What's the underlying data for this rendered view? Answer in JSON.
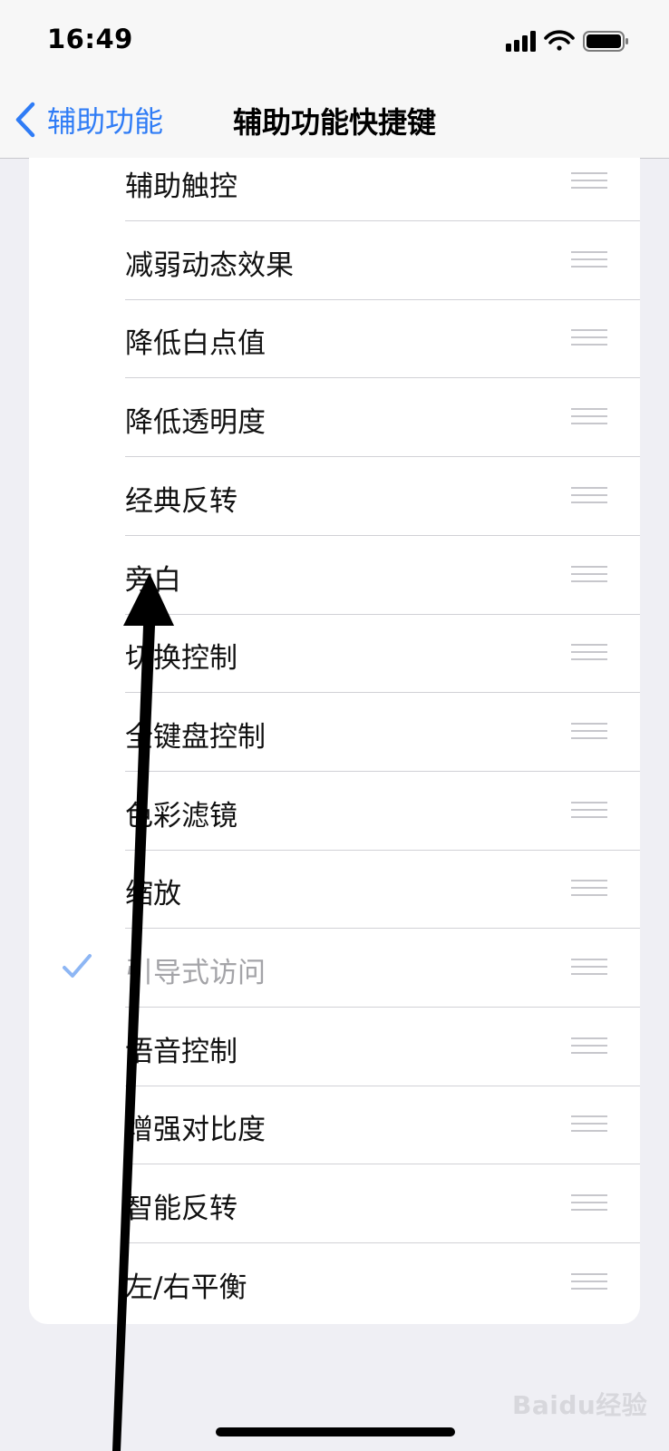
{
  "status_bar": {
    "time": "16:49"
  },
  "nav": {
    "back_label": "辅助功能",
    "title": "辅助功能快捷键"
  },
  "accent_color": "#2F7CF6",
  "items": [
    {
      "label": "辅助触控",
      "checked": false,
      "disabled": false
    },
    {
      "label": "减弱动态效果",
      "checked": false,
      "disabled": false
    },
    {
      "label": "降低白点值",
      "checked": false,
      "disabled": false
    },
    {
      "label": "降低透明度",
      "checked": false,
      "disabled": false
    },
    {
      "label": "经典反转",
      "checked": false,
      "disabled": false
    },
    {
      "label": "旁白",
      "checked": false,
      "disabled": false
    },
    {
      "label": "切换控制",
      "checked": false,
      "disabled": false
    },
    {
      "label": "全键盘控制",
      "checked": false,
      "disabled": false
    },
    {
      "label": "色彩滤镜",
      "checked": false,
      "disabled": false
    },
    {
      "label": "缩放",
      "checked": false,
      "disabled": false
    },
    {
      "label": "引导式访问",
      "checked": true,
      "disabled": true
    },
    {
      "label": "语音控制",
      "checked": false,
      "disabled": false
    },
    {
      "label": "增强对比度",
      "checked": false,
      "disabled": false
    },
    {
      "label": "智能反转",
      "checked": false,
      "disabled": false
    },
    {
      "label": "左/右平衡",
      "checked": false,
      "disabled": false
    }
  ],
  "watermark": {
    "text": "Baidu经验"
  }
}
